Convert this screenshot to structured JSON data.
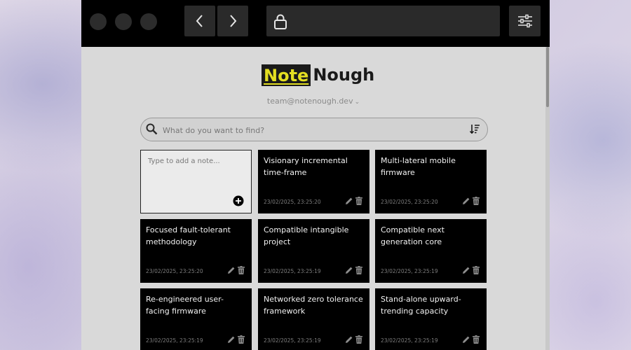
{
  "logo": {
    "part1": "Note",
    "part2": "Nough"
  },
  "account": {
    "email": "team@notenough.dev"
  },
  "search": {
    "placeholder": "What do you want to find?"
  },
  "new_note": {
    "placeholder": "Type to add a note..."
  },
  "notes": [
    {
      "title": "Visionary incremental time-frame",
      "timestamp": "23/02/2025, 23:25:20"
    },
    {
      "title": "Multi-lateral mobile firmware",
      "timestamp": "23/02/2025, 23:25:20"
    },
    {
      "title": "Focused fault-tolerant methodology",
      "timestamp": "23/02/2025, 23:25:20"
    },
    {
      "title": "Compatible intangible project",
      "timestamp": "23/02/2025, 23:25:19"
    },
    {
      "title": "Compatible next generation core",
      "timestamp": "23/02/2025, 23:25:19"
    },
    {
      "title": "Re-engineered user-facing firmware",
      "timestamp": "23/02/2025, 23:25:19"
    },
    {
      "title": "Networked zero tolerance framework",
      "timestamp": "23/02/2025, 23:25:19"
    },
    {
      "title": "Stand-alone upward-trending capacity",
      "timestamp": "23/02/2025, 23:25:19"
    }
  ],
  "colors": {
    "accent": "#e3de22",
    "card_bg": "#000000",
    "page_bg": "#d9d9d9"
  },
  "icons": {
    "nav_back": "chevron-left-icon",
    "nav_forward": "chevron-right-icon",
    "address": "lock-icon",
    "settings": "sliders-icon",
    "search": "search-icon",
    "sort": "sort-icon",
    "add": "plus-circle-icon",
    "edit": "pencil-icon",
    "delete": "trash-icon"
  }
}
